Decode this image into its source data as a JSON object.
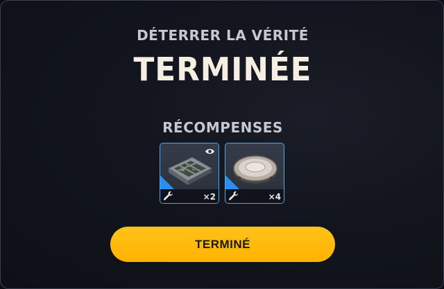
{
  "dialog": {
    "subtitle": "DÉTERRER LA VÉRITÉ",
    "title": "TERMINÉE",
    "rewards_heading": "RÉCOMPENSES"
  },
  "rewards": [
    {
      "item_icon": "parts-tray-icon",
      "category_icon": "wrench-icon",
      "quantity": "×2",
      "inspect_icon": "eye-icon"
    },
    {
      "item_icon": "metal-disc-icon",
      "category_icon": "wrench-icon",
      "quantity": "×4"
    }
  ],
  "buttons": {
    "done_label": "TERMINÉ"
  },
  "colors": {
    "accent_button": "#ffb300",
    "card_border": "#4aa9f0",
    "title": "#f6eee2"
  }
}
